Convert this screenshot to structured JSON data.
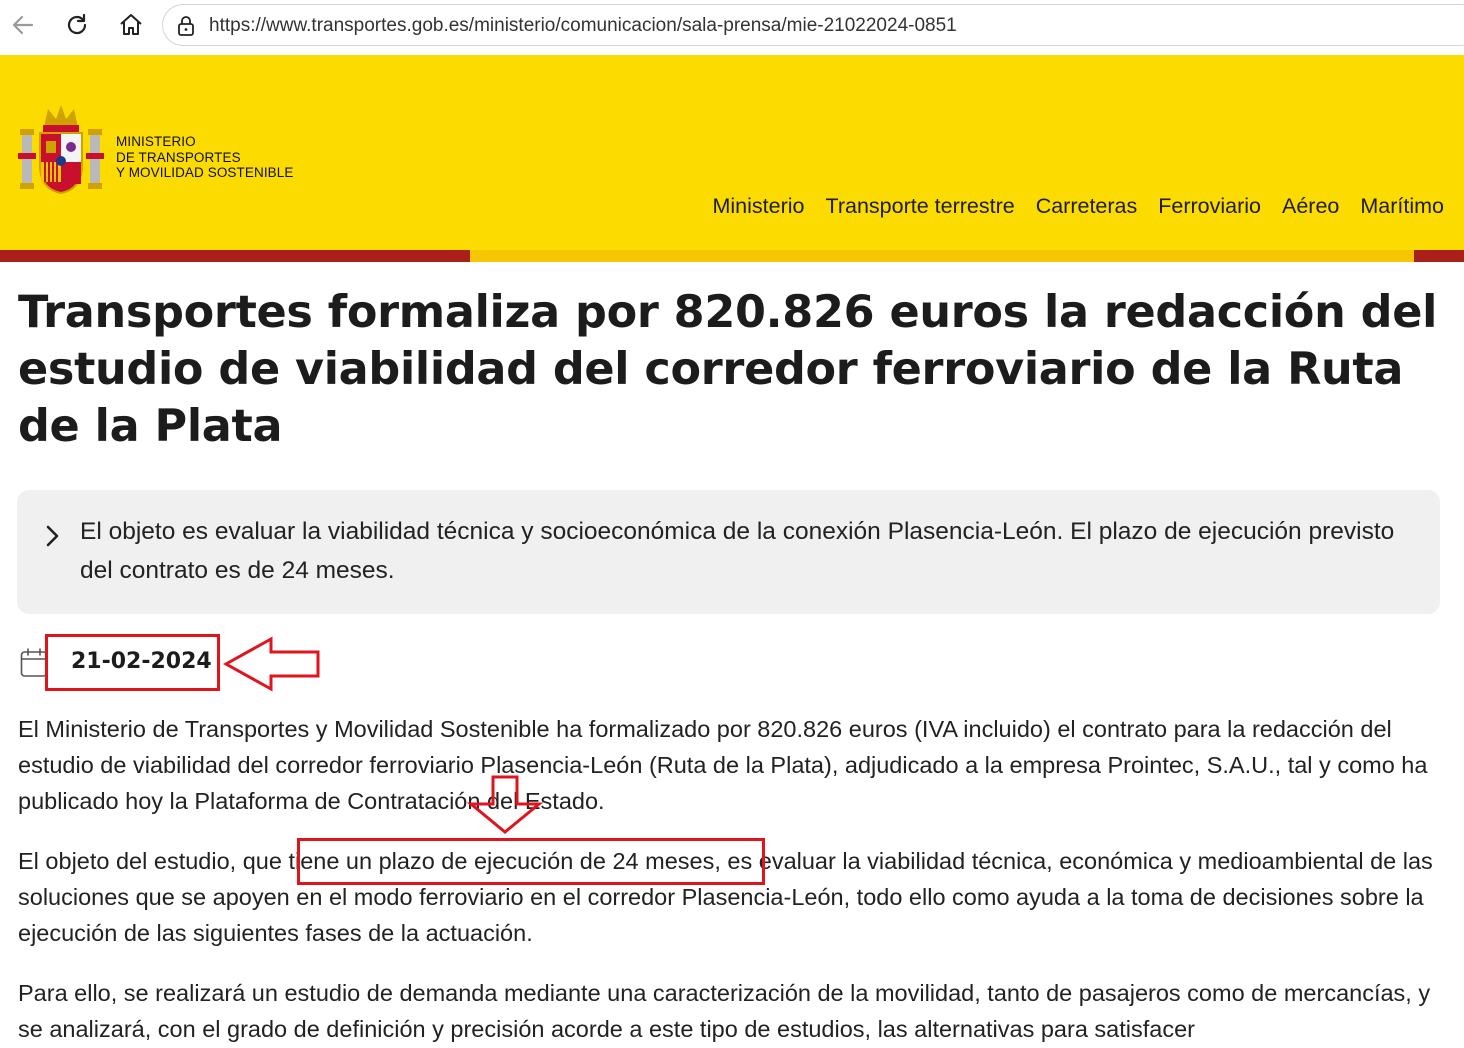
{
  "browser": {
    "url": "https://www.transportes.gob.es/ministerio/comunicacion/sala-prensa/mie-21022024-0851"
  },
  "header": {
    "ministry_lines": [
      "MINISTERIO",
      "DE TRANSPORTES",
      "Y MOVILIDAD SOSTENIBLE"
    ],
    "nav": [
      "Ministerio",
      "Transporte terrestre",
      "Carreteras",
      "Ferroviario",
      "Aéreo",
      "Marítimo"
    ]
  },
  "article": {
    "title": "Transportes formaliza por 820.826 euros la redacción del estudio de viabilidad del corredor ferroviario de la Ruta de la Plata",
    "summary": "El objeto es evaluar la viabilidad técnica y socioeconómica de la conexión Plasencia-León. El plazo de ejecución previsto del contrato es de 24 meses.",
    "date": "21-02-2024",
    "paragraphs": [
      "El Ministerio de Transportes y Movilidad Sostenible ha formalizado por 820.826 euros (IVA incluido) el contrato para la redacción del estudio de viabilidad del corredor ferroviario Plasencia-León (Ruta de la Plata), adjudicado a la empresa Prointec, S.A.U., tal y como ha publicado hoy la Plataforma de Contratación del Estado.",
      "El objeto del estudio, que tiene un plazo de ejecución de 24 meses, es evaluar la viabilidad técnica, económica y medioambiental de las soluciones que se apoyen en el modo ferroviario en el corredor Plasencia-León, todo ello como ayuda a la toma de decisiones sobre la ejecución de las siguientes fases de la actuación.",
      "Para ello, se realizará un estudio de demanda mediante una caracterización de la movilidad, tanto de pasajeros como de mercancías, y se analizará, con el grado de definición y precisión acorde a este tipo de estudios, las alternativas para satisfacer"
    ]
  },
  "colors": {
    "header_yellow": "#fcdb00",
    "stripe_red": "#ab1f1b",
    "annotation_red": "#e0141d"
  }
}
